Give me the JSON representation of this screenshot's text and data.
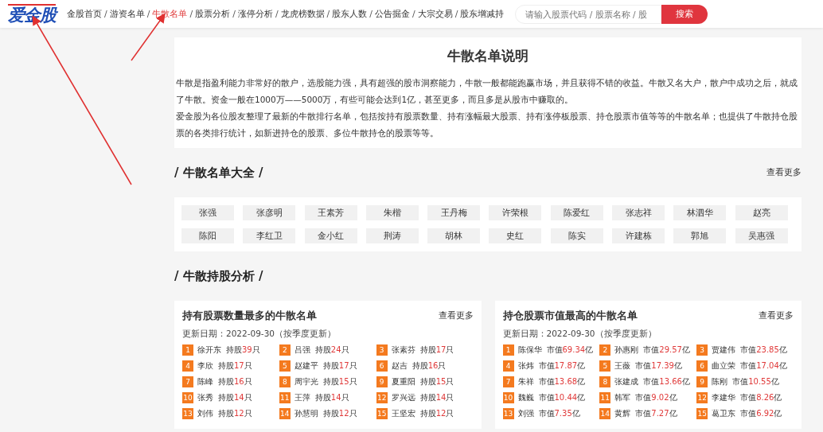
{
  "logo": "爱金股",
  "nav": {
    "items": [
      {
        "label": "金股首页",
        "selected": false,
        "separator": "/"
      },
      {
        "label": "游资名单",
        "selected": false,
        "separator": "/"
      },
      {
        "label": "牛散名单",
        "selected": true,
        "separator": "/"
      },
      {
        "label": "股票分析",
        "selected": false,
        "separator": "/"
      },
      {
        "label": "涨停分析",
        "selected": false,
        "separator": "/"
      },
      {
        "label": "龙虎榜数据",
        "selected": false,
        "separator": "/"
      },
      {
        "label": "股东人数",
        "selected": false,
        "separator": "/"
      },
      {
        "label": "公告掘金",
        "selected": false,
        "separator": "/"
      },
      {
        "label": "大宗交易",
        "selected": false,
        "separator": "/"
      },
      {
        "label": "股东增减持",
        "selected": false
      }
    ]
  },
  "search": {
    "placeholder": "请输入股票代码 / 股票名称 / 股",
    "button": "搜索"
  },
  "intro": {
    "title": "牛散名单说明",
    "paragraphs": [
      "牛散是指盈利能力非常好的散户，选股能力强，具有超强的股市洞察能力，牛散一般都能跑赢市场，并且获得不错的收益。牛散又名大户，散户中成功之后，就成了牛散。资金一般在1000万——5000万，有些可能会达到1亿，甚至更多，而且多是从股市中赚取的。",
      "爱金股为各位股友整理了最新的牛散排行名单，包括按持有股票数量、持有涨幅最大股票、持有涨停板股票、持仓股票市值等等的牛散名单；也提供了牛散持仓股票的各类排行统计，如新进持仓的股票、多位牛散持仓的股票等等。"
    ]
  },
  "directory": {
    "title": "/ 牛散名单大全 /",
    "more": "查看更多",
    "names": [
      "张强",
      "张彦明",
      "王素芳",
      "朱楷",
      "王丹梅",
      "许荣根",
      "陈爱红",
      "张志祥",
      "林泗华",
      "赵亮",
      "陈阳",
      "李红卫",
      "金小红",
      "荆涛",
      "胡林",
      "史红",
      "陈实",
      "许建栋",
      "郭旭",
      "吴惠强"
    ]
  },
  "analysis": {
    "title": "/ 牛散持股分析 /",
    "panels": [
      {
        "title": "持有股票数量最多的牛散名单",
        "more": "查看更多",
        "updated": "更新日期：2022-09-30（按季度更新）",
        "rows": [
          {
            "rank": "1",
            "name": "徐开东",
            "label": "持股",
            "value": "39",
            "unit": "只"
          },
          {
            "rank": "2",
            "name": "吕强",
            "label": "持股",
            "value": "24",
            "unit": "只"
          },
          {
            "rank": "3",
            "name": "张素芬",
            "label": "持股",
            "value": "17",
            "unit": "只"
          },
          {
            "rank": "4",
            "name": "李欣",
            "label": "持股",
            "value": "17",
            "unit": "只"
          },
          {
            "rank": "5",
            "name": "赵建平",
            "label": "持股",
            "value": "17",
            "unit": "只"
          },
          {
            "rank": "6",
            "name": "赵吉",
            "label": "持股",
            "value": "16",
            "unit": "只"
          },
          {
            "rank": "7",
            "name": "陈峰",
            "label": "持股",
            "value": "16",
            "unit": "只"
          },
          {
            "rank": "8",
            "name": "周宇光",
            "label": "持股",
            "value": "15",
            "unit": "只"
          },
          {
            "rank": "9",
            "name": "夏重阳",
            "label": "持股",
            "value": "15",
            "unit": "只"
          },
          {
            "rank": "10",
            "name": "张秀",
            "label": "持股",
            "value": "14",
            "unit": "只"
          },
          {
            "rank": "11",
            "name": "王萍",
            "label": "持股",
            "value": "14",
            "unit": "只"
          },
          {
            "rank": "12",
            "name": "罗兴远",
            "label": "持股",
            "value": "14",
            "unit": "只"
          },
          {
            "rank": "13",
            "name": "刘伟",
            "label": "持股",
            "value": "12",
            "unit": "只"
          },
          {
            "rank": "14",
            "name": "孙慧明",
            "label": "持股",
            "value": "12",
            "unit": "只"
          },
          {
            "rank": "15",
            "name": "王坚宏",
            "label": "持股",
            "value": "12",
            "unit": "只"
          }
        ]
      },
      {
        "title": "持仓股票市值最高的牛散名单",
        "more": "查看更多",
        "updated": "更新日期：2022-09-30（按季度更新）",
        "rows": [
          {
            "rank": "1",
            "name": "陈保华",
            "label": "市值",
            "value": "69.34",
            "unit": "亿"
          },
          {
            "rank": "2",
            "name": "孙惠刚",
            "label": "市值",
            "value": "29.57",
            "unit": "亿"
          },
          {
            "rank": "3",
            "name": "贾建伟",
            "label": "市值",
            "value": "23.85",
            "unit": "亿"
          },
          {
            "rank": "4",
            "name": "张炜",
            "label": "市值",
            "value": "17.87",
            "unit": "亿"
          },
          {
            "rank": "5",
            "name": "王薇",
            "label": "市值",
            "value": "17.39",
            "unit": "亿"
          },
          {
            "rank": "6",
            "name": "曲立荣",
            "label": "市值",
            "value": "17.04",
            "unit": "亿"
          },
          {
            "rank": "7",
            "name": "朱祥",
            "label": "市值",
            "value": "13.68",
            "unit": "亿"
          },
          {
            "rank": "8",
            "name": "张建成",
            "label": "市值",
            "value": "13.66",
            "unit": "亿"
          },
          {
            "rank": "9",
            "name": "陈刚",
            "label": "市值",
            "value": "10.55",
            "unit": "亿"
          },
          {
            "rank": "10",
            "name": "魏巍",
            "label": "市值",
            "value": "10.44",
            "unit": "亿"
          },
          {
            "rank": "11",
            "name": "韩军",
            "label": "市值",
            "value": "9.02",
            "unit": "亿"
          },
          {
            "rank": "12",
            "name": "李建华",
            "label": "市值",
            "value": "8.26",
            "unit": "亿"
          },
          {
            "rank": "13",
            "name": "刘强",
            "label": "市值",
            "value": "7.35",
            "unit": "亿"
          },
          {
            "rank": "14",
            "name": "黄辉",
            "label": "市值",
            "value": "7.27",
            "unit": "亿"
          },
          {
            "rank": "15",
            "name": "葛卫东",
            "label": "市值",
            "value": "6.92",
            "unit": "亿"
          }
        ]
      }
    ]
  }
}
